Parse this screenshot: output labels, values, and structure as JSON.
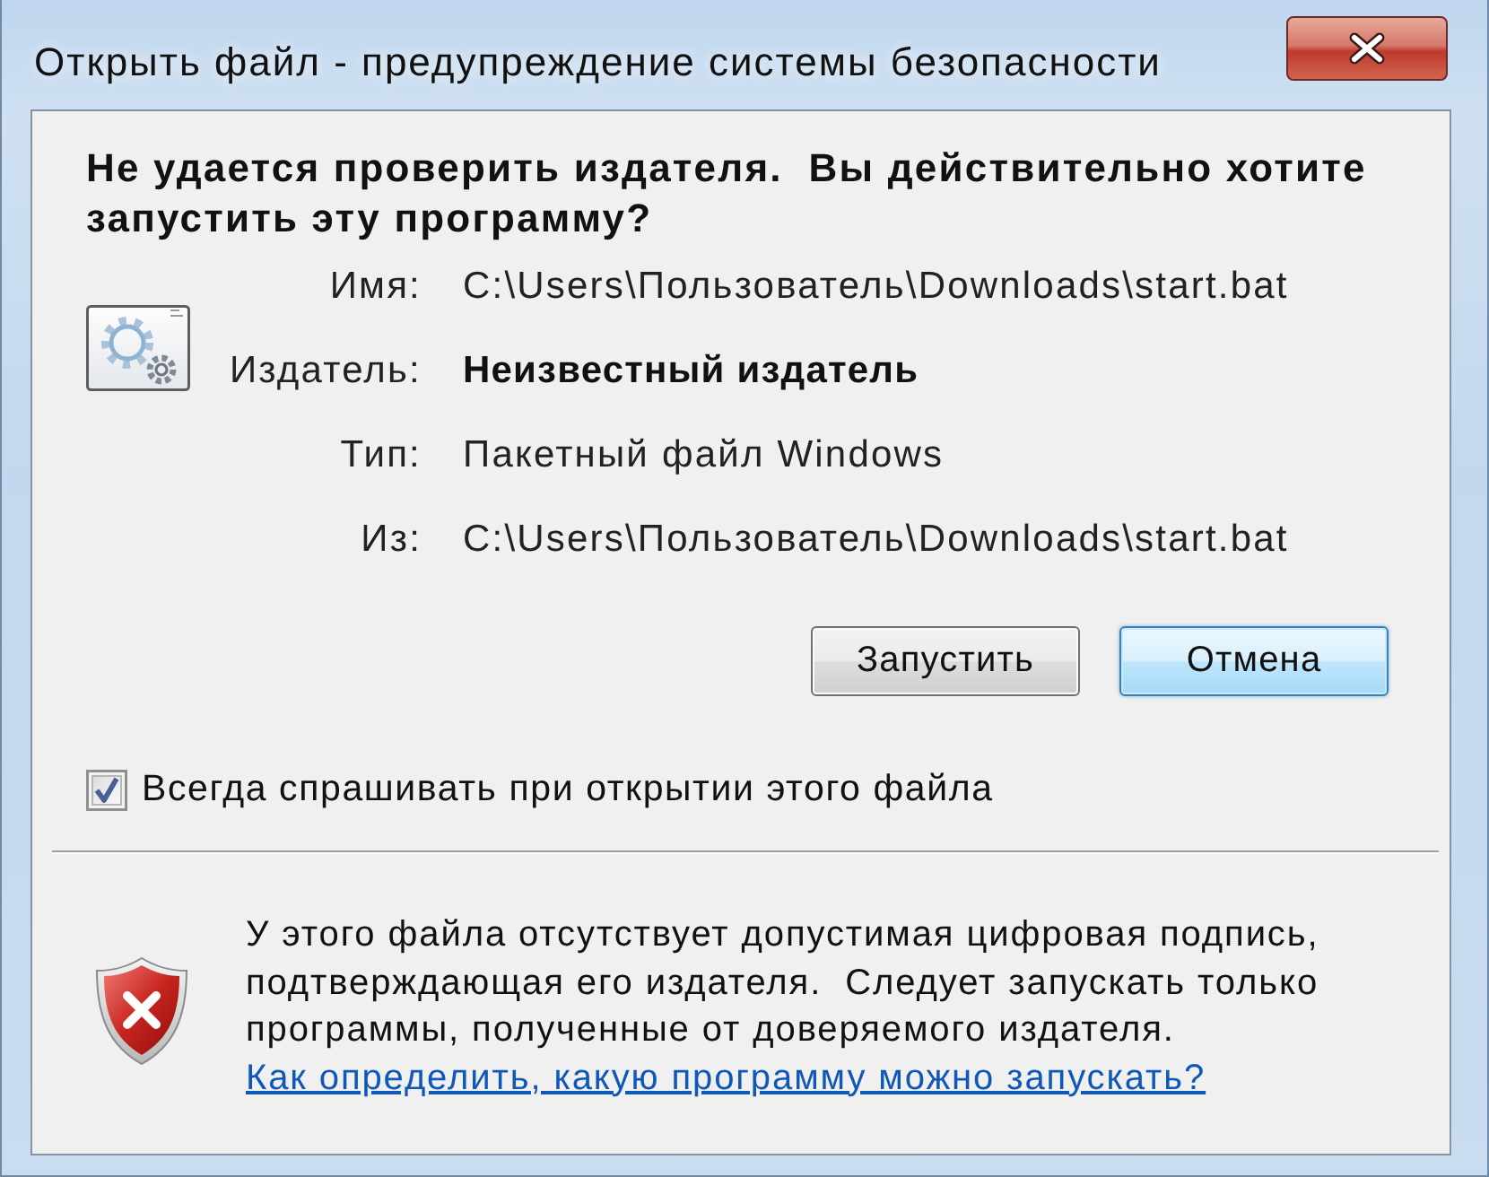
{
  "window": {
    "title": "Открыть файл - предупреждение системы безопасности"
  },
  "heading": "Не удается проверить издателя.  Вы действительно хотите запустить эту программу?",
  "fields": [
    {
      "label": "Имя:",
      "value": "C:\\Users\\Пользователь\\Downloads\\start.bat",
      "bold": false
    },
    {
      "label": "Издатель:",
      "value": "Неизвестный издатель",
      "bold": true
    },
    {
      "label": "Тип:",
      "value": "Пакетный файл Windows",
      "bold": false
    },
    {
      "label": "Из:",
      "value": "C:\\Users\\Пользователь\\Downloads\\start.bat",
      "bold": false
    }
  ],
  "buttons": [
    {
      "label": "Запустить",
      "focused": false
    },
    {
      "label": "Отмена",
      "focused": true
    }
  ],
  "checkbox": {
    "label": "Всегда спрашивать при открытии этого файла",
    "checked": true
  },
  "warning": {
    "text": "У этого файла отсутствует допустимая цифровая подпись, подтверждающая его издателя.  Следует запускать только программы, полученные от доверяемого издателя.",
    "link": "Как определить, какую программу можно запускать?"
  }
}
